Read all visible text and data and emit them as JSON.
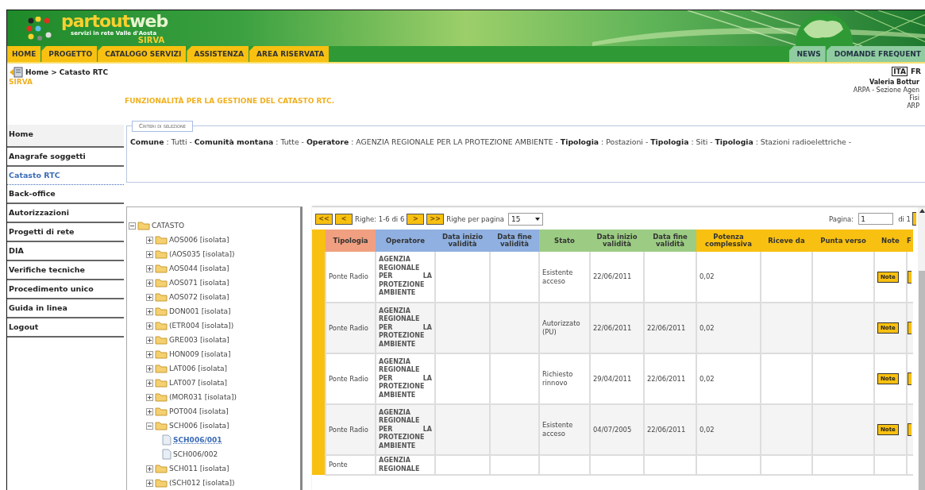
{
  "header": {
    "logo_word_1": "partout",
    "logo_word_2": "web",
    "tagline": "servizi in rete Valle d'Aosta",
    "product": "SIRVA"
  },
  "nav": {
    "left": [
      {
        "label": "HOME"
      },
      {
        "label": "PROGETTO"
      },
      {
        "label": "CATALOGO SERVIZI"
      },
      {
        "label": "ASSISTENZA"
      },
      {
        "label": "AREA RISERVATA"
      }
    ],
    "right": [
      {
        "label": "NEWS"
      },
      {
        "label": "DOMANDE FREQUENT"
      }
    ]
  },
  "breadcrumb": {
    "items": [
      "Home",
      "Catasto RTC"
    ],
    "separator": ">"
  },
  "languages": [
    {
      "label": "ITA",
      "selected": true
    },
    {
      "label": "FR",
      "selected": false
    }
  ],
  "user": {
    "name": "Valeria Bottur",
    "lines": [
      "ARPA - Sezione Agen",
      "Fisi",
      "ARP"
    ]
  },
  "section_label": "SIRVA",
  "page_title": "FUNZIONALITÀ PER LA GESTIONE DEL CATASTO RTC.",
  "sidebar": {
    "items": [
      {
        "label": "Home",
        "selected": false
      },
      {
        "label": "Anagrafe soggetti",
        "selected": false
      },
      {
        "label": "Catasto RTC",
        "selected": true
      },
      {
        "label": "Back-office",
        "selected": false
      },
      {
        "label": "Autorizzazioni",
        "selected": false
      },
      {
        "label": "Progetti di rete",
        "selected": false
      },
      {
        "label": "DIA",
        "selected": false
      },
      {
        "label": "Verifiche tecniche",
        "selected": false
      },
      {
        "label": "Procedimento unico",
        "selected": false
      },
      {
        "label": "Guida in linea",
        "selected": false
      },
      {
        "label": "Logout",
        "selected": false
      }
    ]
  },
  "criteria": {
    "legend": "Criteri di selezione",
    "text": "**Comune** : Tutti - **Comunità montana** : Tutte - **Operatore** : AGENZIA REGIONALE PER LA PROTEZIONE AMBIENTE - **Tipologia** : Postazioni - **Tipologia** : Siti - **Tipologia** : Stazioni radioelettriche -"
  },
  "tree": {
    "label": "CATASTO",
    "kind": "folder",
    "expanded": true,
    "children": [
      {
        "label": "AOS006 [isolata]",
        "kind": "folder",
        "expanded": false
      },
      {
        "label": "(AOS035 [isolata])",
        "kind": "folder",
        "expanded": false
      },
      {
        "label": "AOS044 [isolata]",
        "kind": "folder",
        "expanded": false
      },
      {
        "label": "AOS071 [isolata]",
        "kind": "folder",
        "expanded": false
      },
      {
        "label": "AOS072 [isolata]",
        "kind": "folder",
        "expanded": false
      },
      {
        "label": "DON001 [isolata]",
        "kind": "folder",
        "expanded": false
      },
      {
        "label": "(ETR004 [isolata])",
        "kind": "folder",
        "expanded": false
      },
      {
        "label": "GRE003 [isolata]",
        "kind": "folder",
        "expanded": false
      },
      {
        "label": "HON009 [isolata]",
        "kind": "folder",
        "expanded": false
      },
      {
        "label": "LAT006 [isolata]",
        "kind": "folder",
        "expanded": false
      },
      {
        "label": "LAT007 [isolata]",
        "kind": "folder",
        "expanded": false
      },
      {
        "label": "(MOR031 [isolata])",
        "kind": "folder",
        "expanded": false
      },
      {
        "label": "POT004 [isolata]",
        "kind": "folder",
        "expanded": false
      },
      {
        "label": "SCH006 [isolata]",
        "kind": "folder",
        "expanded": true,
        "children": [
          {
            "label": "SCH006/001",
            "kind": "file",
            "selected": true
          },
          {
            "label": "SCH006/002",
            "kind": "file",
            "selected": false
          }
        ]
      },
      {
        "label": "SCH011 [isolata]",
        "kind": "folder",
        "expanded": false
      },
      {
        "label": "(SCH012 [isolata])",
        "kind": "folder",
        "expanded": false
      }
    ]
  },
  "pager": {
    "first": "<<",
    "prev": "<",
    "rows_info": "Righe: 1-6 di 6",
    "next": ">",
    "last": ">>",
    "per_page_label": "Righe per pagina",
    "per_page": "15",
    "page_label": "Pagina:",
    "page": "1",
    "page_total": "di 1"
  },
  "table": {
    "columns": [
      {
        "label": "Tipologia",
        "color": "#f0a080",
        "kind": "text"
      },
      {
        "label": "Operatore",
        "color": "#8fb0e0",
        "kind": "justify"
      },
      {
        "label": "Data inizio validità",
        "color": "#8fb0e0",
        "kind": "text"
      },
      {
        "label": "Data fine validità",
        "color": "#8fb0e0",
        "kind": "text"
      },
      {
        "label": "Stato",
        "color": "#9ccc84",
        "kind": "text"
      },
      {
        "label": "Data inizio validità",
        "color": "#9ccc84",
        "kind": "text"
      },
      {
        "label": "Data fine validità",
        "color": "#9ccc84",
        "kind": "text"
      },
      {
        "label": "Potenza complessiva",
        "color": "#f8c010",
        "kind": "text"
      },
      {
        "label": "Riceve da",
        "color": "#f8c010",
        "kind": "text"
      },
      {
        "label": "Punta verso",
        "color": "#f8c010",
        "kind": "text"
      },
      {
        "label": "Note",
        "color": "#f8c010",
        "kind": "button"
      },
      {
        "label": "F",
        "color": "#f8c010",
        "kind": "cut"
      }
    ],
    "rows": [
      {
        "tipologia": "Ponte Radio",
        "operatore": "AGENZIA REGIONALE PER LA PROTEZIONE AMBIENTE",
        "stato": "Esistente acceso",
        "inizio_2": "22/06/2011",
        "potenza": "0,02",
        "note": "Note"
      },
      {
        "tipologia": "Ponte Radio",
        "operatore": "AGENZIA REGIONALE PER LA PROTEZIONE AMBIENTE",
        "stato": "Autorizzato (PU)",
        "inizio_2": "22/06/2011",
        "fine_2": "22/06/2011",
        "potenza": "0,02",
        "note": "Note"
      },
      {
        "tipologia": "Ponte Radio",
        "operatore": "AGENZIA REGIONALE PER LA PROTEZIONE AMBIENTE",
        "stato": "Richiesto rinnovo",
        "inizio_2": "29/04/2011",
        "fine_2": "22/06/2011",
        "potenza": "0,02",
        "note": "Note"
      },
      {
        "tipologia": "Ponte Radio",
        "operatore": "AGENZIA REGIONALE PER LA PROTEZIONE AMBIENTE",
        "stato": "Esistente acceso",
        "inizio_2": "04/07/2005",
        "fine_2": "22/06/2011",
        "potenza": "0,02",
        "note": "Note"
      },
      {
        "tipologia": "Ponte",
        "operatore": "AGENZIA REGIONALE"
      }
    ]
  }
}
